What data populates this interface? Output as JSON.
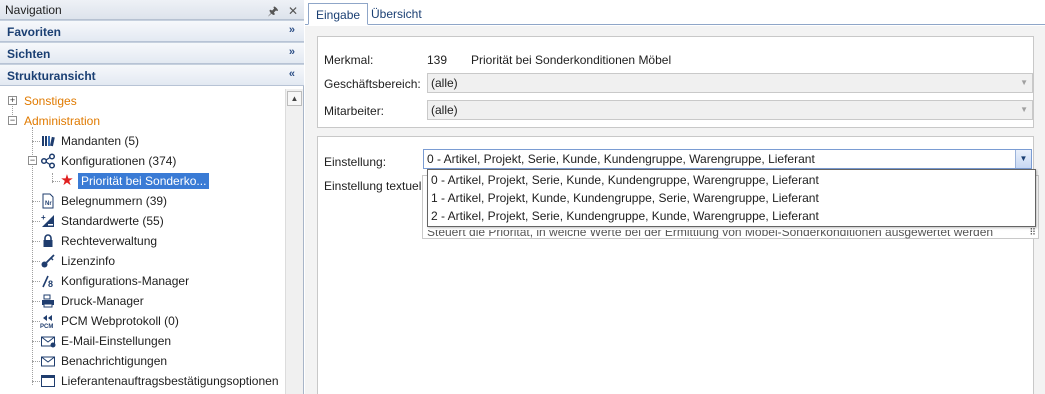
{
  "nav": {
    "title": "Navigation",
    "pin_icon": "pin-icon",
    "close_icon": "close-icon",
    "sections": [
      {
        "label": "Favoriten",
        "chevron": "»"
      },
      {
        "label": "Sichten",
        "chevron": "»"
      },
      {
        "label": "Strukturansicht",
        "chevron": "«"
      }
    ],
    "tree": {
      "sonstiges": "Sonstiges",
      "administration": "Administration",
      "items": [
        {
          "label": "Mandanten (5)",
          "icon": "library-icon"
        },
        {
          "label": "Konfigurationen (374)",
          "icon": "share-icon"
        },
        {
          "label": "Priorität bei Sonderko...",
          "icon": "star-icon"
        },
        {
          "label": "Belegnummern (39)",
          "icon": "document-number-icon"
        },
        {
          "label": "Standardwerte (55)",
          "icon": "plus-minus-icon"
        },
        {
          "label": "Rechteverwaltung",
          "icon": "lock-icon"
        },
        {
          "label": "Lizenzinfo",
          "icon": "key-icon"
        },
        {
          "label": "Konfigurations-Manager",
          "icon": "config-manager-icon"
        },
        {
          "label": "Druck-Manager",
          "icon": "print-manager-icon"
        },
        {
          "label": "PCM Webprotokoll (0)",
          "icon": "pcm-icon"
        },
        {
          "label": "E-Mail-Einstellungen",
          "icon": "mail-settings-icon"
        },
        {
          "label": "Benachrichtigungen",
          "icon": "notification-icon"
        },
        {
          "label": "Lieferantenauftragsbestätigungsoptionen",
          "icon": "window-icon"
        }
      ]
    }
  },
  "tabs": [
    {
      "label": "Eingabe",
      "active": true
    },
    {
      "label": "Übersicht",
      "active": false
    }
  ],
  "form": {
    "merkmal_label": "Merkmal:",
    "merkmal_number": "139",
    "merkmal_name": "Priorität bei Sonderkonditionen Möbel",
    "geschaeftsbereich_label": "Geschäftsbereich:",
    "geschaeftsbereich_value": "(alle)",
    "mitarbeiter_label": "Mitarbeiter:",
    "mitarbeiter_value": "(alle)",
    "einstellung_label": "Einstellung:",
    "einstellung_value": "0 - Artikel, Projekt, Serie, Kunde, Kundengruppe, Warengruppe, Lieferant",
    "einstellung_textuell_label": "Einstellung textuell:",
    "dropdown_options": [
      "0 - Artikel, Projekt, Serie, Kunde, Kundengruppe, Warengruppe, Lieferant",
      "1 - Artikel, Projekt, Kunde, Kundengruppe, Serie, Warengruppe, Lieferant",
      "2 - Artikel, Projekt, Serie, Kundengruppe, Kunde, Warengruppe, Lieferant"
    ],
    "description": "Steuert die Priorität, in welche Werte bei der Ermittlung von Möbel-Sonderkonditionen ausgewertet werden"
  },
  "colors": {
    "accent": "#3a7bd5",
    "orange_node": "#e07a00",
    "star": "#e02020"
  }
}
